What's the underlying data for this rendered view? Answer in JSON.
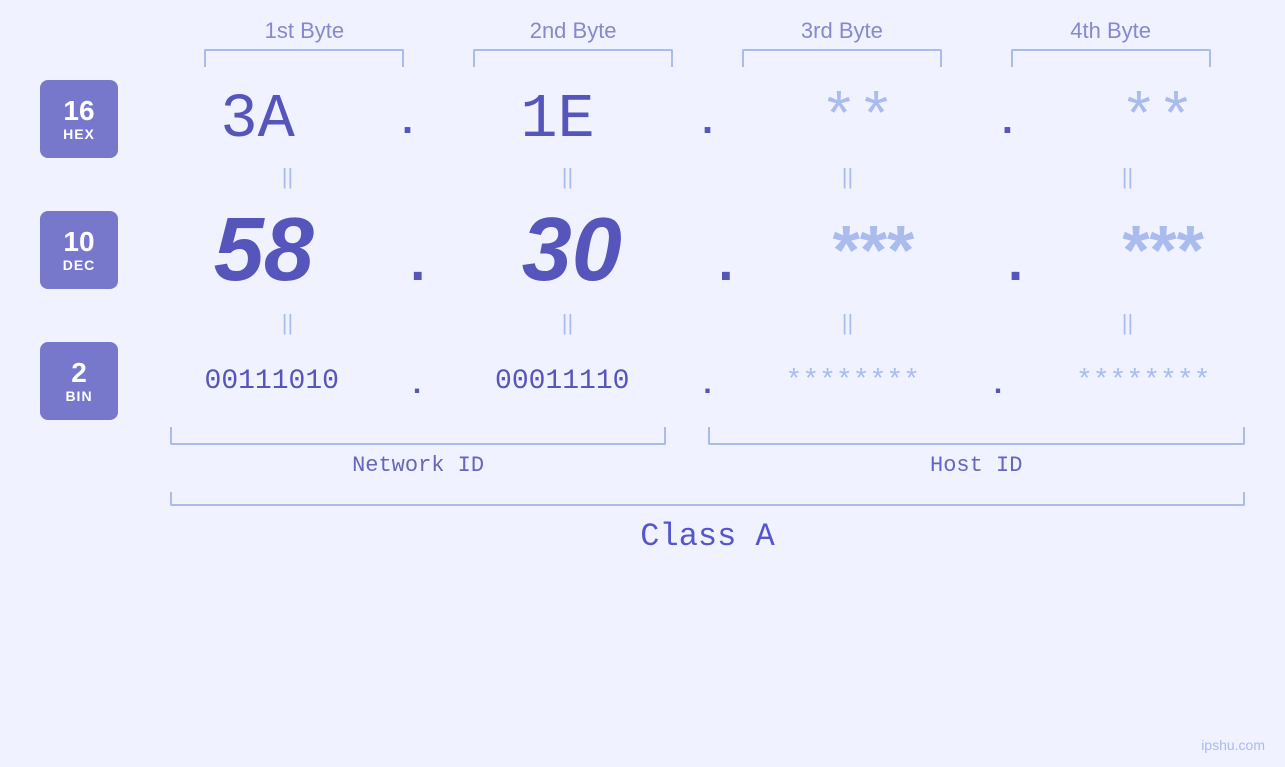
{
  "headers": {
    "byte1": "1st Byte",
    "byte2": "2nd Byte",
    "byte3": "3rd Byte",
    "byte4": "4th Byte"
  },
  "badges": {
    "hex": {
      "number": "16",
      "label": "HEX"
    },
    "dec": {
      "number": "10",
      "label": "DEC"
    },
    "bin": {
      "number": "2",
      "label": "BIN"
    }
  },
  "values": {
    "hex": {
      "b1": "3A",
      "b2": "1E",
      "b3": "**",
      "b4": "**"
    },
    "dec": {
      "b1": "58",
      "b2": "30",
      "b3": "***",
      "b4": "***"
    },
    "bin": {
      "b1": "00111010",
      "b2": "00011110",
      "b3": "********",
      "b4": "********"
    }
  },
  "labels": {
    "network_id": "Network ID",
    "host_id": "Host ID",
    "class": "Class A",
    "equals": "||",
    "dot": ".",
    "watermark": "ipshu.com"
  }
}
